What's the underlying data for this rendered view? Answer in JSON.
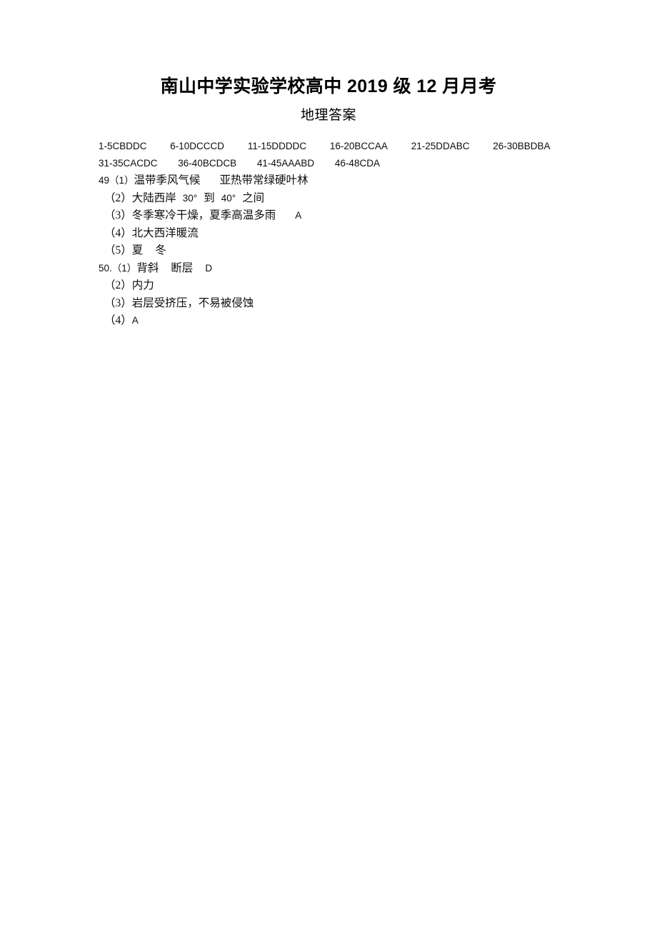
{
  "document": {
    "title": "南山中学实验学校高中 2019 级 12 月月考",
    "subtitle": "地理答案"
  },
  "multiple_choice": {
    "row1": [
      "1-5CBDDC",
      "6-10DCCCD",
      "11-15DDDDC",
      "16-20BCCAA",
      "21-25DDABC",
      "26-30BBDBA"
    ],
    "row2": [
      "31-35CACDC",
      "36-40BCDCB",
      "41-45AAABD",
      "46-48CDA"
    ]
  },
  "question_49": {
    "part1_number": "49（1）",
    "part1_answer_a": "温带季风气候",
    "part1_answer_b": "亚热带常绿硬叶林",
    "part2_number": "（2）",
    "part2_text_a": "大陆西岸",
    "part2_value_a": "30°",
    "part2_text_b": "到",
    "part2_value_b": "40°",
    "part2_text_c": "之间",
    "part3_number": "（3）",
    "part3_text": "冬季寒冷干燥，夏季高温多雨",
    "part3_choice": "A",
    "part4_number": "（4）",
    "part4_text": "北大西洋暖流",
    "part5_number": "（5）",
    "part5_answer_a": "夏",
    "part5_answer_b": "冬"
  },
  "question_50": {
    "part1_number": "50.（1）",
    "part1_answer_a": "背斜",
    "part1_answer_b": "断层",
    "part1_choice": "D",
    "part2_number": "（2）",
    "part2_text": "内力",
    "part3_number": "（3）",
    "part3_text": "岩层受挤压，不易被侵蚀",
    "part4_number": "（4）",
    "part4_choice": "A"
  },
  "colors": {
    "page_background": "#ffffff",
    "text": "#0d0d0d"
  }
}
